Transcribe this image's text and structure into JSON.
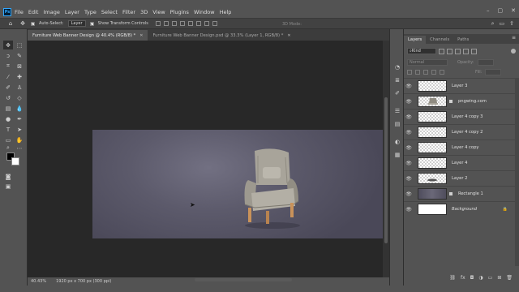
{
  "menu": {
    "logo": "Ps",
    "items": [
      "File",
      "Edit",
      "Image",
      "Layer",
      "Type",
      "Select",
      "Filter",
      "3D",
      "View",
      "Plugins",
      "Window",
      "Help"
    ]
  },
  "options": {
    "auto_select_label": "Auto-Select:",
    "auto_select_value": "Layer",
    "transform_label": "Show Transform Controls",
    "mode_3d": "3D Mode:"
  },
  "tabs": [
    {
      "label": "Furniture Web Banner Design @ 40.4% (RGB/8) *",
      "active": true
    },
    {
      "label": "Furniture Web Banner Design.psd @ 33.3% (Layer 1, RGB/8) *",
      "active": false
    }
  ],
  "status": {
    "zoom": "40.43%",
    "doc_size": "1920 px x 700 px (300 ppi)"
  },
  "panel": {
    "tabs": [
      "Layers",
      "Channels",
      "Paths"
    ],
    "kind_label": "Kind",
    "blend_mode": "Normal",
    "opacity_label": "Opacity:",
    "fill_label": "Fill:"
  },
  "layers": [
    {
      "name": "Layer 3",
      "type": "checker",
      "selected": false
    },
    {
      "name": "pngwing.com",
      "type": "chair",
      "selected": false,
      "linked": true
    },
    {
      "name": "Layer 4 copy 3",
      "type": "checker",
      "selected": false
    },
    {
      "name": "Layer 4 copy 2",
      "type": "checker",
      "selected": false
    },
    {
      "name": "Layer 4 copy",
      "type": "checker",
      "selected": false
    },
    {
      "name": "Layer 4",
      "type": "checker",
      "selected": false
    },
    {
      "name": "Layer 2",
      "type": "checker",
      "selected": false
    },
    {
      "name": "Rectangle 1",
      "type": "dark",
      "selected": false,
      "linked": true
    },
    {
      "name": "Background",
      "type": "white",
      "selected": false,
      "italic": true,
      "locked": true
    }
  ],
  "colors": {
    "canvas_bg": "#5c5a6b",
    "chair_fabric": "#a8a49a",
    "chair_legs": "#c9925a"
  }
}
